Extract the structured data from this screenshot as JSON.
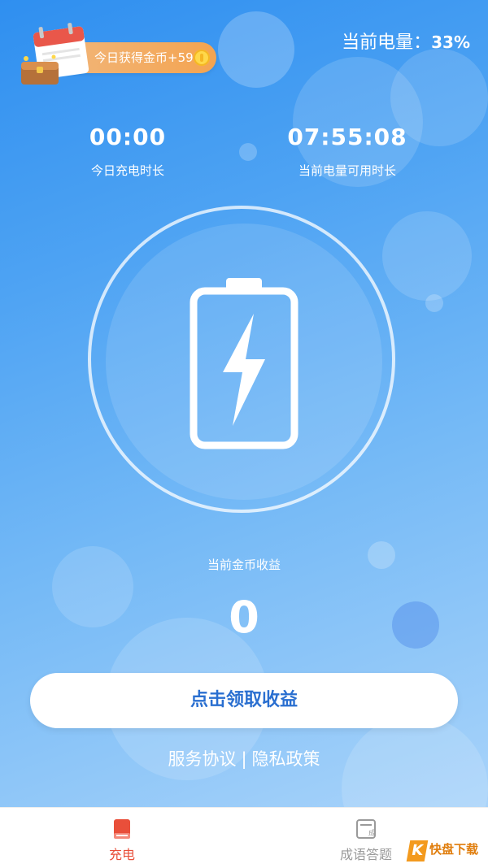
{
  "header": {
    "battery_label": "当前电量：",
    "battery_value": "33%",
    "coin_reward": "今日获得金币+59"
  },
  "stats": {
    "charge_time_value": "00:00",
    "charge_time_label": "今日充电时长",
    "usable_time_value": "07:55:08",
    "usable_time_label": "当前电量可用时长"
  },
  "earnings": {
    "label": "当前金币收益",
    "value": "0"
  },
  "actions": {
    "claim_label": "点击领取收益"
  },
  "legal": {
    "terms": "服务协议",
    "separator": "|",
    "privacy": "隐私政策"
  },
  "tabs": [
    {
      "label": "充电",
      "icon": "book-icon",
      "active": true
    },
    {
      "label": "成语答题",
      "icon": "quiz-card-icon",
      "active": false
    }
  ],
  "watermark": {
    "badge": "K",
    "text": "快盘下载"
  },
  "colors": {
    "background_top": "#2f8ff0",
    "background_bottom": "#a8d3fa",
    "accent_orange": "#f4a451",
    "tab_active": "#e94f3a",
    "button_text": "#2a6fd0"
  }
}
